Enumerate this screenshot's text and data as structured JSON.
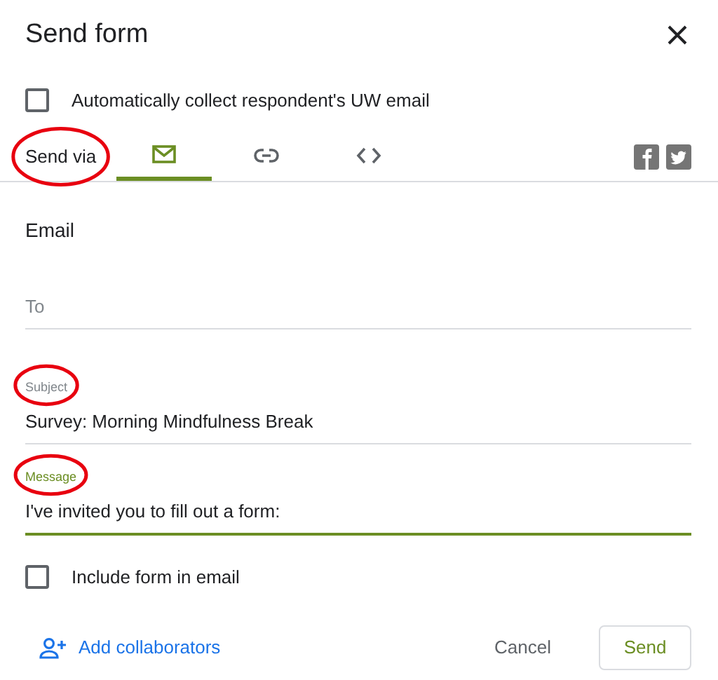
{
  "dialog": {
    "title": "Send form"
  },
  "collect_email": {
    "label": "Automatically collect respondent's UW email",
    "checked": false
  },
  "send_via": {
    "label": "Send via",
    "circled": true
  },
  "tabs": [
    {
      "kind": "email",
      "selected": true
    },
    {
      "kind": "link",
      "selected": false
    },
    {
      "kind": "embed",
      "selected": false
    }
  ],
  "share": [
    {
      "kind": "facebook"
    },
    {
      "kind": "twitter"
    }
  ],
  "section_title": "Email",
  "fields": [
    {
      "placeholder": "To",
      "focused": false
    },
    {
      "label": "Subject",
      "value": "Survey: Morning Mindfulness Break",
      "circled": true,
      "focused": false
    },
    {
      "label": "Message",
      "value": "I've invited you to fill out a form:",
      "circled": true,
      "focused": true
    }
  ],
  "include_form": {
    "label": "Include form in email",
    "checked": false
  },
  "footer": {
    "collaborators": "Add collaborators",
    "cancel": "Cancel",
    "send": "Send"
  }
}
